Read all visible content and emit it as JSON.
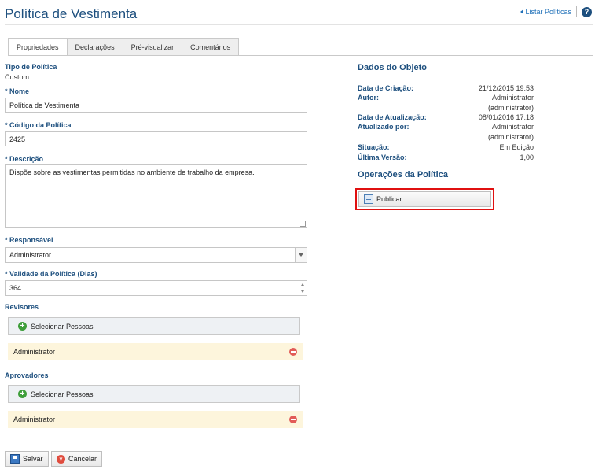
{
  "page": {
    "title": "Política de Vestimenta",
    "list_link": "Listar Políticas",
    "help_icon": "?"
  },
  "tabs": [
    {
      "label": "Propriedades",
      "active": true
    },
    {
      "label": "Declarações",
      "active": false
    },
    {
      "label": "Pré-visualizar",
      "active": false
    },
    {
      "label": "Comentários",
      "active": false
    }
  ],
  "form": {
    "tipo_label": "Tipo de Política",
    "tipo_value": "Custom",
    "nome_label": "* Nome",
    "nome_value": "Política de Vestimenta",
    "codigo_label": "* Código da Política",
    "codigo_value": "2425",
    "descricao_label": "* Descrição",
    "descricao_value": "Dispõe sobre as vestimentas permitidas no ambiente de trabalho da empresa.",
    "responsavel_label": "* Responsável",
    "responsavel_value": "Administrator",
    "validade_label": "* Validade da Política (Dias)",
    "validade_value": "364",
    "revisores_label": "Revisores",
    "revisores_select": "Selecionar Pessoas",
    "revisores_person": "Administrator",
    "aprovadores_label": "Aprovadores",
    "aprovadores_select": "Selecionar Pessoas",
    "aprovadores_person": "Administrator"
  },
  "actions": {
    "save_label": "Salvar",
    "cancel_label": "Cancelar"
  },
  "object_data": {
    "title": "Dados do Objeto",
    "criacao_label": "Data de Criação:",
    "criacao_value": "21/12/2015 19:53",
    "autor_label": "Autor:",
    "autor_value": "Administrator",
    "autor_value2": "(administrator)",
    "atualizacao_label": "Data de Atualização:",
    "atualizacao_value": "08/01/2016 17:18",
    "atualizado_label": "Atualizado por:",
    "atualizado_value": "Administrator",
    "atualizado_value2": "(administrator)",
    "situacao_label": "Situação:",
    "situacao_value": "Em Edição",
    "versao_label": "Última Versão:",
    "versao_value": "1,00"
  },
  "operations": {
    "title": "Operações da Política",
    "publish_label": "Publicar"
  },
  "colors": {
    "title_blue": "#1d4f7e",
    "link_blue": "#1d6fb8",
    "highlight_red": "#e01010",
    "person_row_bg": "#fdf5dc"
  }
}
